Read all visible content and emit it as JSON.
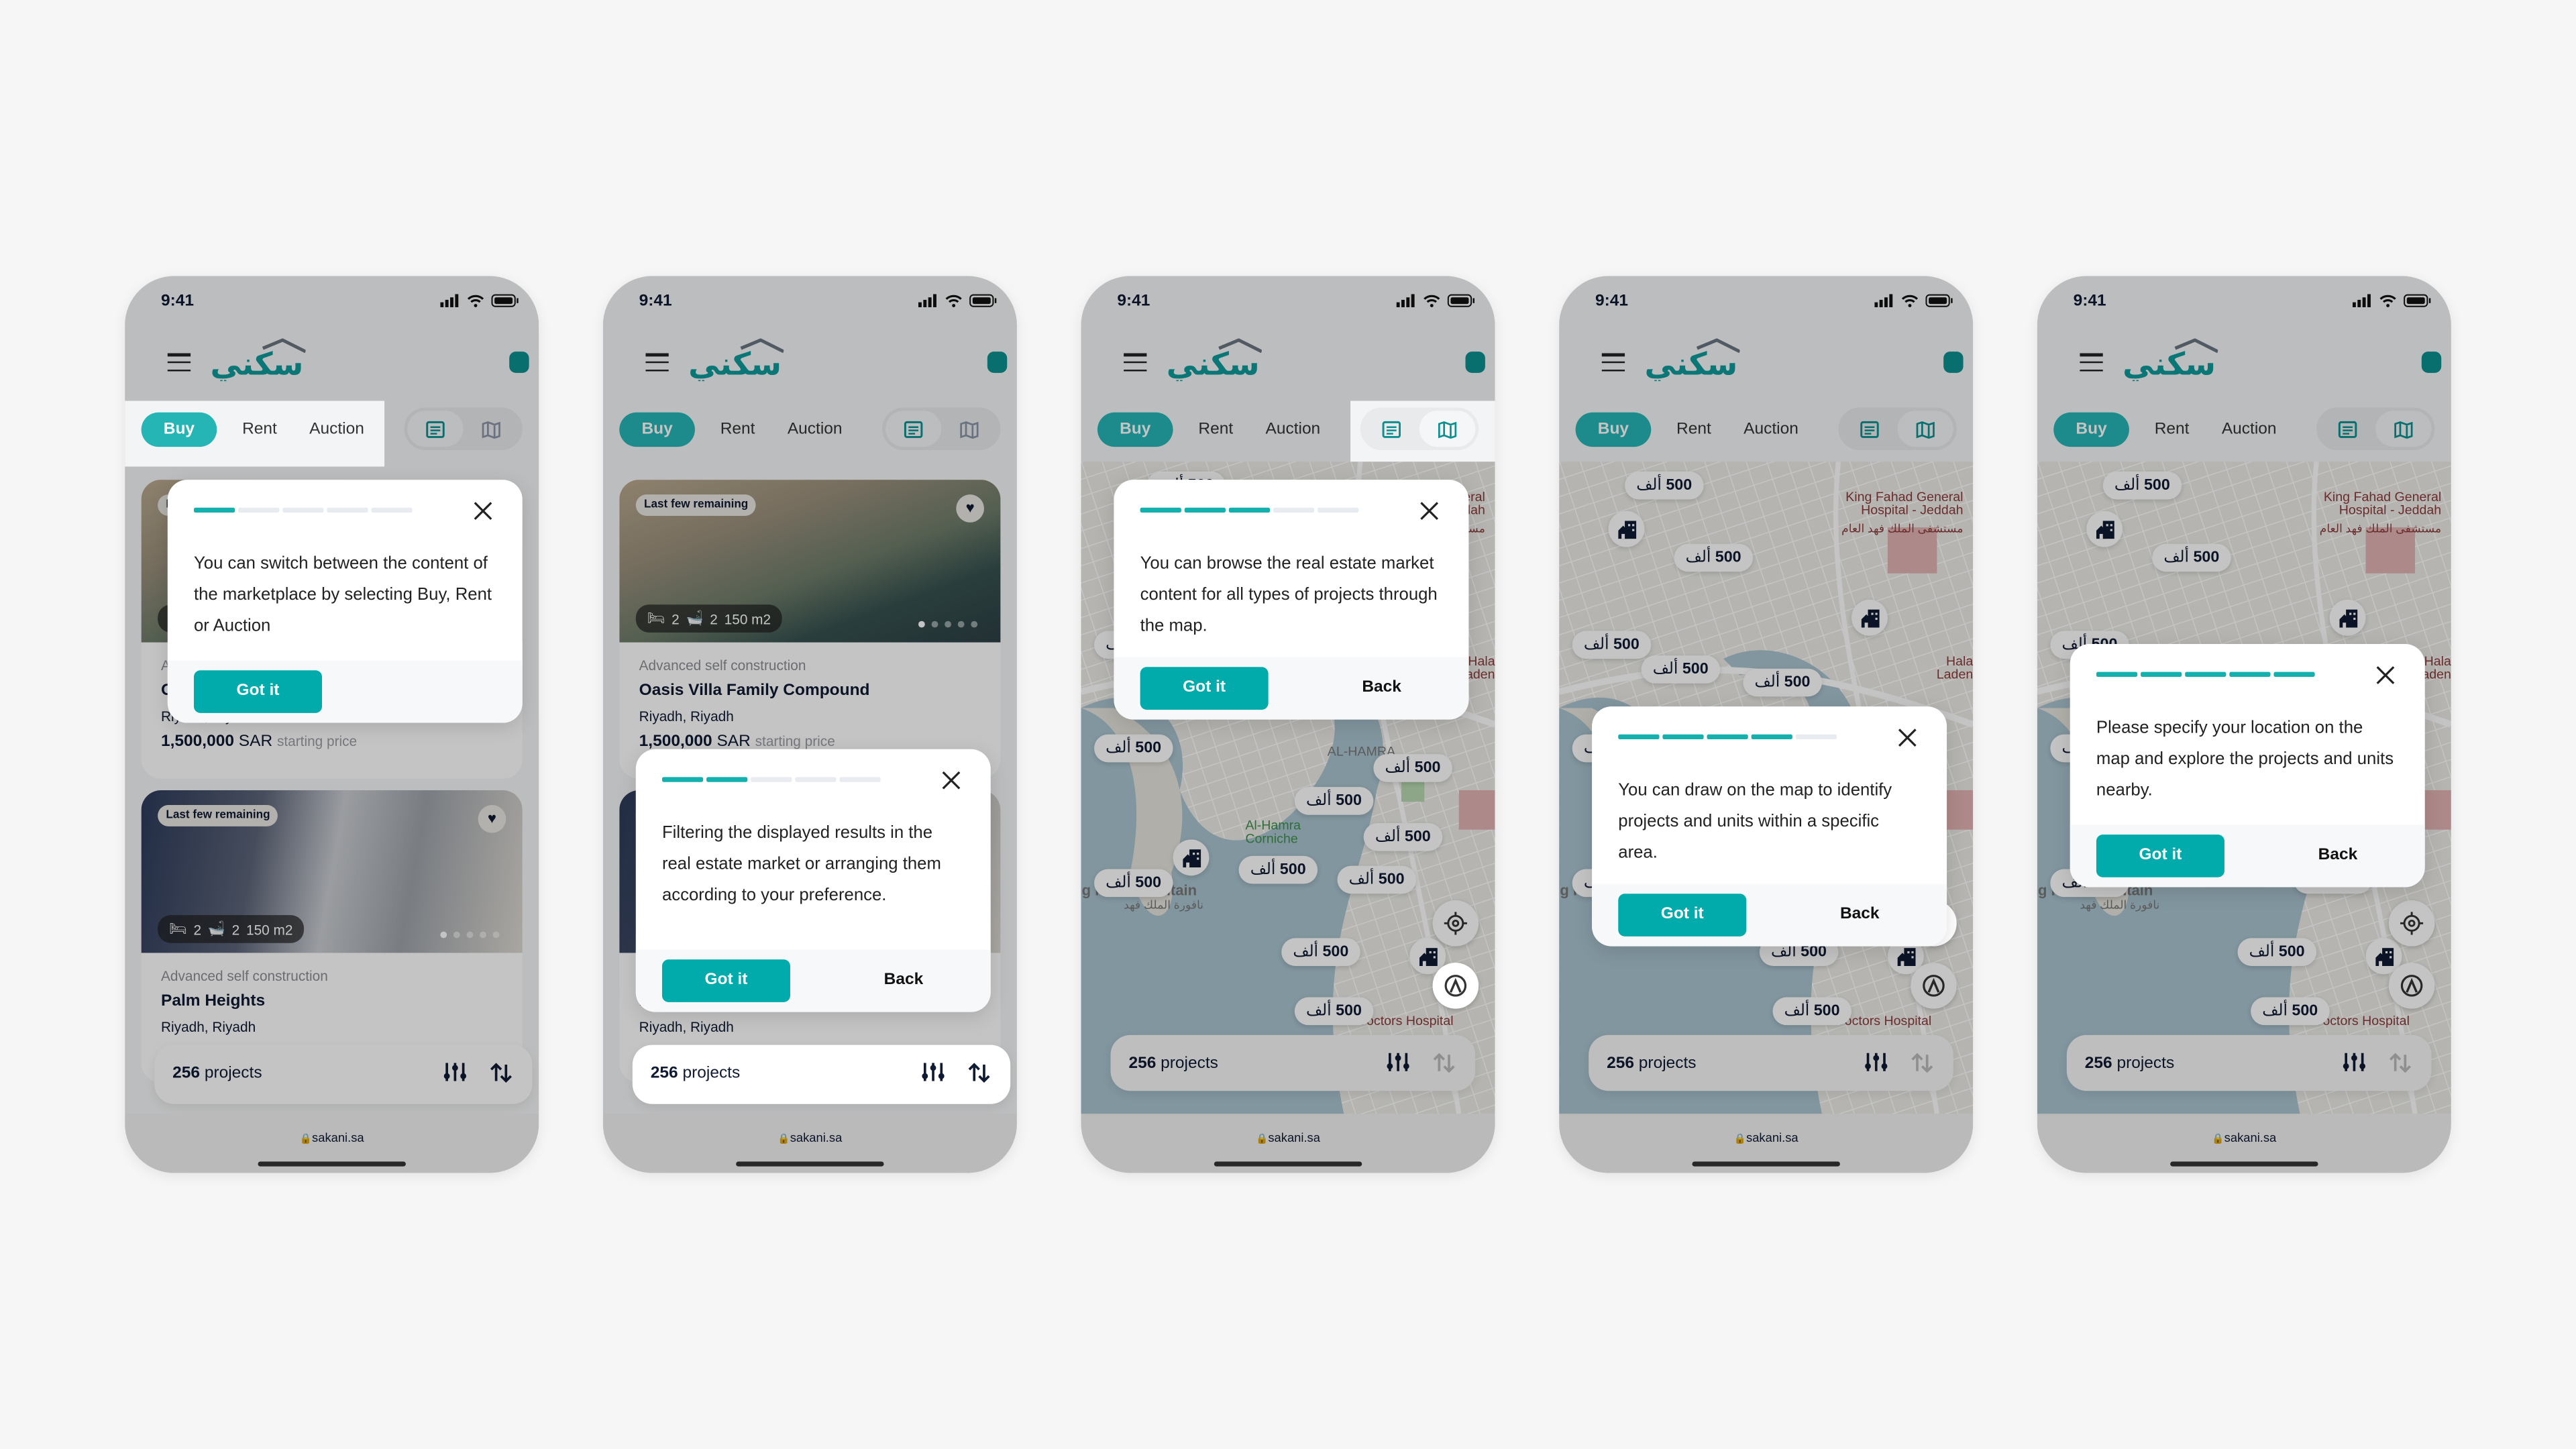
{
  "status": {
    "time": "9:41"
  },
  "header": {
    "logo_text": "سكني",
    "menu_icon": "hamburger-icon",
    "profile_icon": "user-icon"
  },
  "tabs": [
    {
      "label": "Buy"
    },
    {
      "label": "Rent"
    },
    {
      "label": "Auction"
    }
  ],
  "view_toggle": {
    "list_icon": "list-view-icon",
    "map_icon": "map-view-icon"
  },
  "listings": [
    {
      "badge": "Last few remaining",
      "beds": "2",
      "baths": "2",
      "area": "150 m2",
      "subtitle": "Advanced self construction",
      "title": "Oasis Villa Family Compound",
      "location": "Riyadh, Riyadh",
      "price": "1,500,000",
      "currency": "SAR",
      "price_note": "starting price"
    },
    {
      "badge": "Last few remaining",
      "beds": "2",
      "baths": "2",
      "area": "150 m2",
      "subtitle": "Advanced self construction",
      "title": "Palm Heights",
      "location": "Riyadh, Riyadh"
    }
  ],
  "bottom_bar": {
    "count": "256",
    "count_label": "projects"
  },
  "url": "sakani.sa",
  "map": {
    "marker_value": "500",
    "marker_unit": "ألف",
    "labels": {
      "hospital_en": "King Fahad General Hospital - Jeddah",
      "hospital_ar": "مستشفى الملك فهد العام",
      "corniche": "Al-Hamra Corniche",
      "district": "AL-HAMRA",
      "doctors": "Doctors Hospital",
      "fountain": "King Fahd Fountain",
      "fountain_ar": "نافورة الملك فهد",
      "hala": "Hala Laden"
    }
  },
  "colors": {
    "accent": "#02abab",
    "tab_active": "#26b5b5",
    "text": "#0f1a33",
    "water": "#a9c3cf"
  },
  "tooltip_buttons": {
    "primary": "Got it",
    "secondary": "Back"
  },
  "screens": [
    {
      "view": "list",
      "step": 1,
      "total_steps": 5,
      "text": "You can switch between the content of the marketplace by selecting Buy, Rent or Auction",
      "has_back": false
    },
    {
      "view": "list",
      "step": 2,
      "total_steps": 5,
      "text": "Filtering the displayed results in the real estate market or arranging them according to your preference.",
      "has_back": true
    },
    {
      "view": "map",
      "step": 3,
      "total_steps": 5,
      "text": "You can browse the real estate market content for all types of projects through the map.",
      "has_back": true
    },
    {
      "view": "map",
      "step": 4,
      "total_steps": 5,
      "text": "You can draw on the map to identify projects and units within a specific area.",
      "has_back": true
    },
    {
      "view": "map",
      "step": 5,
      "total_steps": 5,
      "text": "Please specify your location on the map and explore the projects and units nearby.",
      "has_back": true
    }
  ]
}
